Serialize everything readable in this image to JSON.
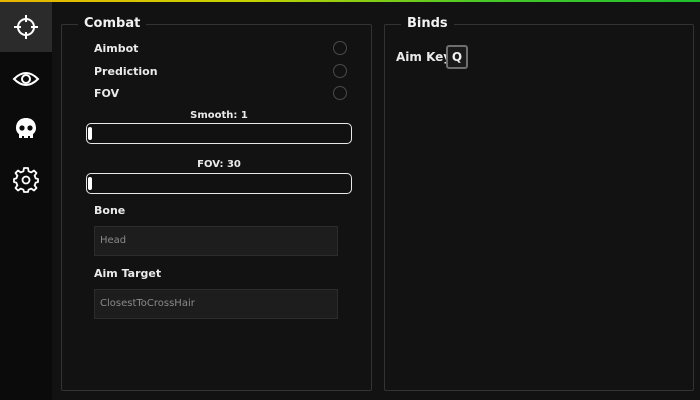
{
  "colors": {
    "accent_start": "#e8b400",
    "accent_end": "#1fbf2e",
    "background": "#121212",
    "sidebar": "#0b0b0b",
    "active_tab": "#2b2b2b"
  },
  "sidebar": {
    "items": [
      {
        "icon": "crosshair-icon",
        "active": true
      },
      {
        "icon": "eye-icon",
        "active": false
      },
      {
        "icon": "skull-icon",
        "active": false
      },
      {
        "icon": "gear-icon",
        "active": false
      }
    ]
  },
  "combat": {
    "title": "Combat",
    "toggles": [
      {
        "label": "Aimbot",
        "checked": false
      },
      {
        "label": "Prediction",
        "checked": false
      },
      {
        "label": "FOV",
        "checked": false
      }
    ],
    "smooth": {
      "label": "Smooth: 1",
      "value": 1,
      "fill_fraction": 0.0
    },
    "fov": {
      "label": "FOV: 30",
      "value": 30,
      "fill_fraction": 0.0
    },
    "bone": {
      "label": "Bone",
      "value": "Head"
    },
    "aim_target": {
      "label": "Aim Target",
      "value": "ClosestToCrossHair"
    }
  },
  "binds": {
    "title": "Binds",
    "aim_key_label": "Aim Key",
    "aim_key_value": "Q"
  }
}
